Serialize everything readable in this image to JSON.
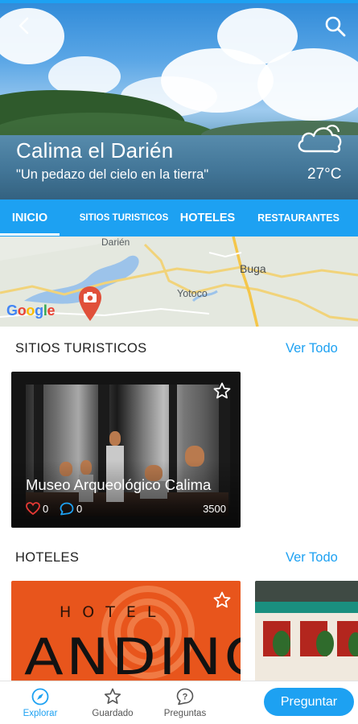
{
  "header": {
    "title": "Calima el Darién",
    "slogan": "\"Un pedazo del cielo en la tierra\"",
    "temperature": "27°C",
    "weather_icon": "cloud-icon",
    "back_icon": "back-arrow-icon",
    "search_icon": "search-icon"
  },
  "tabs": [
    {
      "label": "INICIO",
      "active": true
    },
    {
      "label": "SITIOS TURISTICOS",
      "active": false
    },
    {
      "label": "HOTELES",
      "active": false
    },
    {
      "label": "RESTAURANTES",
      "active": false
    }
  ],
  "map": {
    "labels": {
      "darien": "Darién",
      "buga": "Buga",
      "yotoco": "Yotoco"
    },
    "google": "Google"
  },
  "sections": {
    "sites": {
      "title": "SITIOS TURISTICOS",
      "see_all": "Ver Todo",
      "cards": [
        {
          "name": "Museo Arqueológico Calima",
          "likes": "0",
          "comments": "0",
          "count": "3500"
        }
      ]
    },
    "hotels": {
      "title": "HOTELES",
      "see_all": "Ver Todo",
      "cards": [
        {
          "logo_top": "HOTEL",
          "logo_name": "ANDINO"
        }
      ]
    }
  },
  "bottom_nav": {
    "items": [
      {
        "label": "Explorar",
        "icon": "compass-icon",
        "active": true
      },
      {
        "label": "Guardado",
        "icon": "star-icon",
        "active": false
      },
      {
        "label": "Preguntas",
        "icon": "question-bubble-icon",
        "active": false
      }
    ],
    "ask_button": "Preguntar"
  },
  "colors": {
    "accent": "#1da1f2",
    "hotel_brand": "#e8551c",
    "like": "#e53935"
  }
}
